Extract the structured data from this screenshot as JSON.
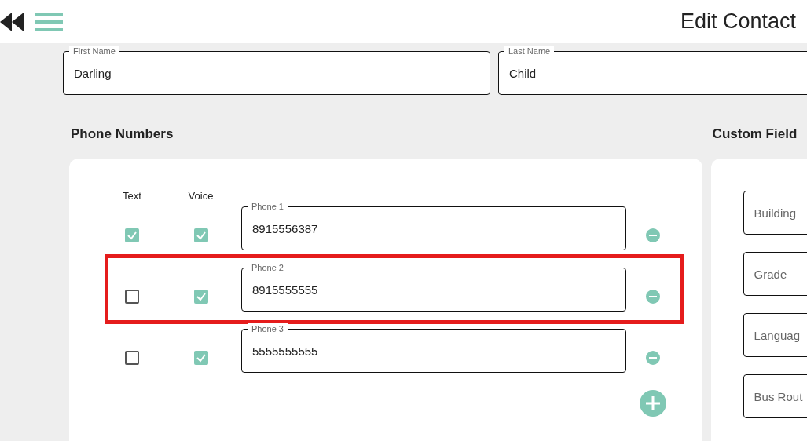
{
  "header": {
    "title": "Edit Contact"
  },
  "name_fields": [
    {
      "label": "First Name",
      "value": "Darling"
    },
    {
      "label": "Last Name",
      "value": "Child"
    }
  ],
  "phone_numbers": {
    "heading": "Phone Numbers",
    "column_labels": [
      "Text",
      "Voice"
    ],
    "rows": [
      {
        "text": true,
        "voice": true,
        "label": "Phone 1",
        "value": "8915556387",
        "highlighted": false
      },
      {
        "text": false,
        "voice": true,
        "label": "Phone 2",
        "value": "8915555555",
        "highlighted": true
      },
      {
        "text": false,
        "voice": true,
        "label": "Phone 3",
        "value": "5555555555",
        "highlighted": false
      }
    ]
  },
  "custom_fields": {
    "heading": "Custom Field",
    "fields": [
      {
        "placeholder": "Building"
      },
      {
        "placeholder": "Grade"
      },
      {
        "placeholder": "Languag"
      },
      {
        "placeholder": "Bus Rout"
      }
    ]
  }
}
